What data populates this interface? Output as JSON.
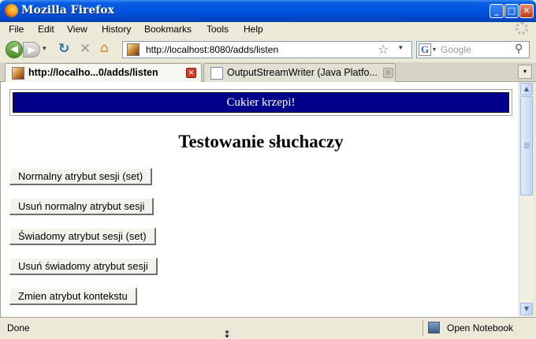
{
  "window": {
    "title": "Mozilla Firefox",
    "minimize_glyph": "_",
    "maximize_glyph": "□",
    "close_glyph": "✕"
  },
  "menubar": {
    "items": [
      "File",
      "Edit",
      "View",
      "History",
      "Bookmarks",
      "Tools",
      "Help"
    ]
  },
  "navbar": {
    "back_glyph": "◀",
    "forward_glyph": "▶",
    "dropdown_glyph": "▾",
    "reload_glyph": "↻",
    "stop_glyph": "✕",
    "home_glyph": "⌂",
    "url": "http://localhost:8080/adds/listen",
    "bookmark_star_glyph": "☆",
    "search": {
      "engine_glyph": "G",
      "placeholder": "Google",
      "search_glyph": "⚲"
    }
  },
  "tabs": [
    {
      "label": "http://localho...0/adds/listen",
      "active": true
    },
    {
      "label": "OutputStreamWriter (Java Platfo...",
      "active": false
    }
  ],
  "tab_close_glyph": "✕",
  "tab_list_glyph": "▾",
  "page": {
    "banner": "Cukier krzepi!",
    "heading": "Testowanie słuchaczy",
    "buttons": [
      "Normalny atrybut sesji (set)",
      "Usuń normalny atrybut sesji",
      "Świadomy atrybut sesji (set)",
      "Usuń świadomy atrybut sesji",
      "Zmien atrybut kontekstu"
    ]
  },
  "scrollbar": {
    "up_glyph": "▲",
    "down_glyph": "▼"
  },
  "statusbar": {
    "status": "Done",
    "notebook_label": "Open Notebook",
    "cursor_glyph": "↕"
  },
  "colors": {
    "titlebar_blue": "#0054e3",
    "banner_navy": "#00008b",
    "close_red": "#c43a12"
  },
  "icons": [
    "firefox-icon",
    "back-icon",
    "forward-icon",
    "reload-icon",
    "stop-icon",
    "home-icon",
    "site-favicon",
    "bookmark-star-icon",
    "google-icon",
    "search-icon",
    "page-favicon",
    "document-icon",
    "notebook-icon"
  ]
}
